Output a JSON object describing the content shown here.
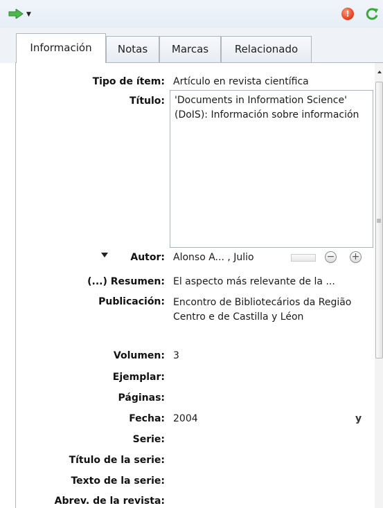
{
  "tabs": [
    {
      "label": "Información",
      "active": true
    },
    {
      "label": "Notas",
      "active": false
    },
    {
      "label": "Marcas",
      "active": false
    },
    {
      "label": "Relacionado",
      "active": false
    }
  ],
  "fields": {
    "item_type": {
      "label": "Tipo de ítem:",
      "value": "Artículo en revista científica"
    },
    "title": {
      "label": "Título:",
      "value": "'Documents in Information Science' (DoIS): Información sobre información"
    },
    "author": {
      "label": "Autor:",
      "value": "Alonso A... , Julio"
    },
    "abstract": {
      "label": "(...) Resumen:",
      "value": "El aspecto más relevante de la ..."
    },
    "publication": {
      "label": "Publicación:",
      "value": "Encontro de Bibliotecários da Região Centro e de Castilla y Léon"
    },
    "volume": {
      "label": "Volumen:",
      "value": "3"
    },
    "issue": {
      "label": "Ejemplar:",
      "value": ""
    },
    "pages": {
      "label": "Páginas:",
      "value": ""
    },
    "date": {
      "label": "Fecha:",
      "value": "2004",
      "format_hint": "y"
    },
    "series": {
      "label": "Serie:",
      "value": ""
    },
    "series_title": {
      "label": "Título de la serie:",
      "value": ""
    },
    "series_text": {
      "label": "Texto de la serie:",
      "value": ""
    },
    "journal_abbr": {
      "label": "Abrev. de la revista:",
      "value": ""
    }
  },
  "author_buttons": {
    "remove": "−",
    "add": "+"
  },
  "toolbar": {
    "stop_glyph": "!"
  },
  "colors": {
    "accent_green": "#3aa83a",
    "stop_red": "#e03a1a"
  }
}
